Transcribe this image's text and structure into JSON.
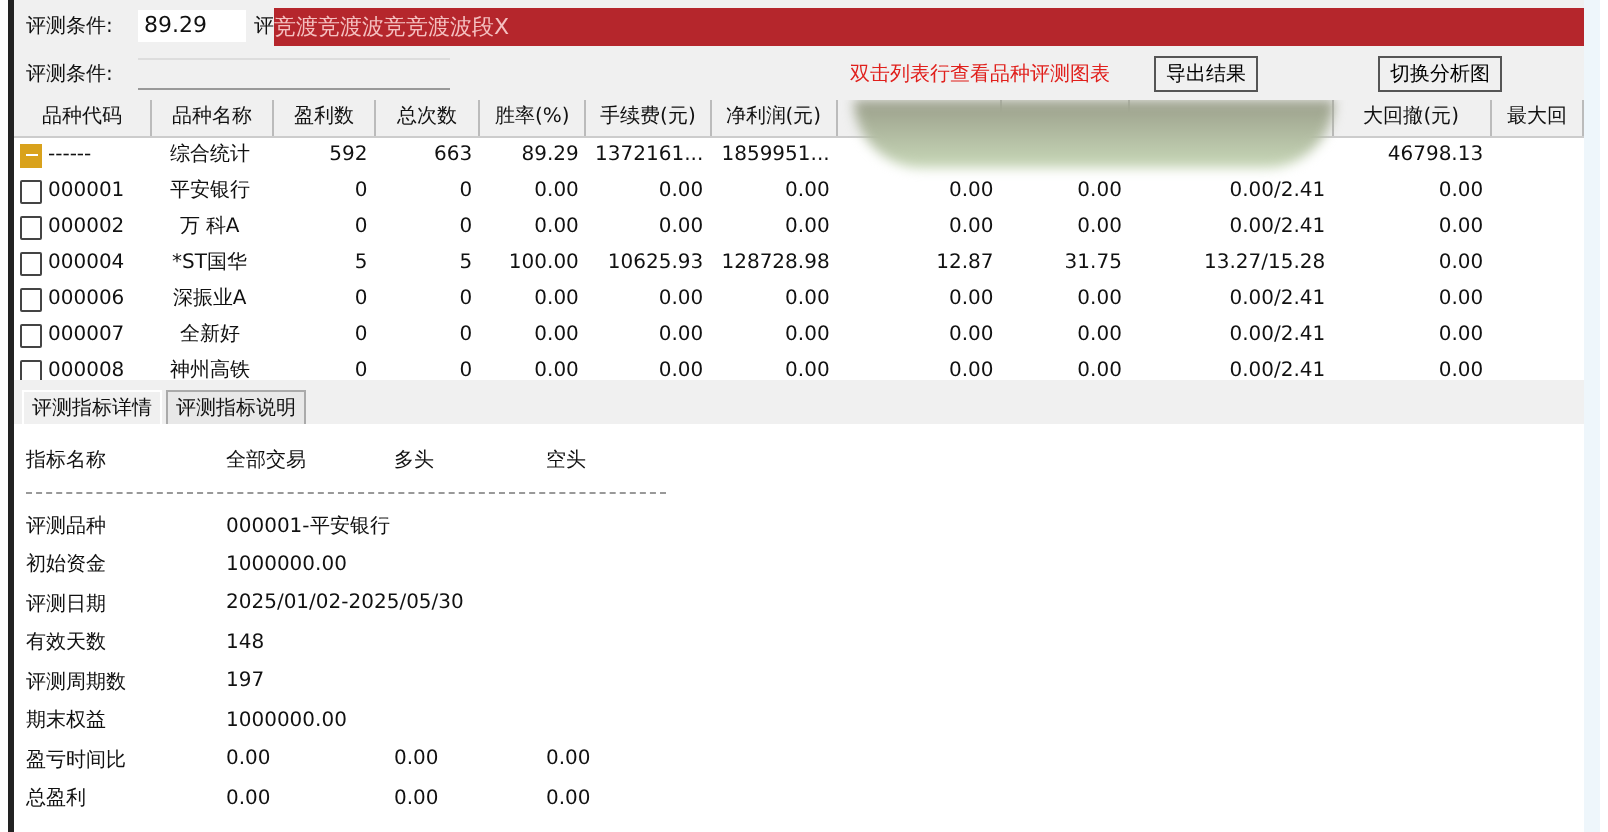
{
  "conditions": [
    {
      "label": "评测条件:",
      "value": "89.29",
      "trailing": "评"
    },
    {
      "label": "评测条件:"
    }
  ],
  "banner": {
    "text": "竞渡竞渡波竞竞渡波段X"
  },
  "hint": "双击列表行查看品种评测图表",
  "buttons": [
    "导出结果",
    "切换分析图"
  ],
  "table": {
    "columns": [
      "品种代码",
      "品种名称",
      "盈利数",
      "总次数",
      "胜率(%)",
      "手续费(元)",
      "净利润(元)",
      null,
      null,
      null,
      "大回撤(元)",
      "最大回"
    ],
    "rows": [
      {
        "kind": "summary",
        "cells": [
          "------",
          "综合统计",
          "592",
          "663",
          "89.29",
          "1372161...",
          "1859951...",
          null,
          null,
          null,
          "46798.13",
          null
        ]
      },
      {
        "kind": "item",
        "cells": [
          "000001",
          "平安银行",
          "0",
          "0",
          "0.00",
          "0.00",
          "0.00",
          "0.00",
          "0.00",
          "0.00/2.41",
          "0.00",
          null
        ]
      },
      {
        "kind": "item",
        "cells": [
          "000002",
          "万 科A",
          "0",
          "0",
          "0.00",
          "0.00",
          "0.00",
          "0.00",
          "0.00",
          "0.00/2.41",
          "0.00",
          null
        ]
      },
      {
        "kind": "item",
        "cells": [
          "000004",
          "*ST国华",
          "5",
          "5",
          "100.00",
          "10625.93",
          "128728.98",
          "12.87",
          "31.75",
          "13.27/15.28",
          "0.00",
          null
        ]
      },
      {
        "kind": "item",
        "cells": [
          "000006",
          "深振业A",
          "0",
          "0",
          "0.00",
          "0.00",
          "0.00",
          "0.00",
          "0.00",
          "0.00/2.41",
          "0.00",
          null
        ]
      },
      {
        "kind": "item",
        "cells": [
          "000007",
          "全新好",
          "0",
          "0",
          "0.00",
          "0.00",
          "0.00",
          "0.00",
          "0.00",
          "0.00/2.41",
          "0.00",
          null
        ]
      },
      {
        "kind": "item",
        "cells": [
          "000008",
          "神州高铁",
          "0",
          "0",
          "0.00",
          "0.00",
          "0.00",
          "0.00",
          "0.00",
          "0.00/2.41",
          "0.00",
          null
        ]
      }
    ]
  },
  "tabs": [
    {
      "label": "评测指标详情",
      "selected": true
    },
    {
      "label": "评测指标说明",
      "selected": false
    }
  ],
  "details": {
    "header": [
      "指标名称",
      "全部交易",
      "多头",
      "空头"
    ],
    "rows": [
      [
        "评测品种",
        "000001-平安银行"
      ],
      [
        "初始资金",
        "1000000.00"
      ],
      [
        "评测日期",
        "2025/01/02-2025/05/30"
      ],
      [
        "有效天数",
        "148"
      ],
      [
        "评测周期数",
        "197"
      ],
      [
        "期末权益",
        "1000000.00"
      ],
      [
        "盈亏时间比",
        "0.00",
        "0.00",
        "0.00"
      ],
      [
        "总盈利",
        "0.00",
        "0.00",
        "0.00"
      ]
    ]
  }
}
